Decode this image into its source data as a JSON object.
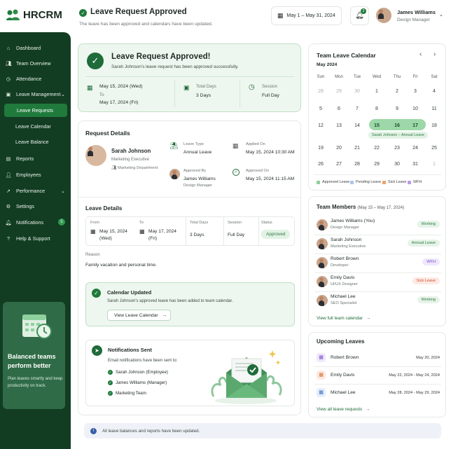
{
  "app": {
    "name": "HRCRM"
  },
  "header": {
    "title": "Leave Request Approved",
    "subtitle": "The leave has been approved and calendars have been updated.",
    "date_range": "May 1 – May 31, 2024",
    "notif_count": "3",
    "user_name": "James Williams",
    "user_role": "Design Manager"
  },
  "sidebar": {
    "items": [
      {
        "label": "Dashboard",
        "icon": "home-icon"
      },
      {
        "label": "Team Overview",
        "icon": "users-icon"
      },
      {
        "label": "Attendance",
        "icon": "clock-icon"
      },
      {
        "label": "Leave Management",
        "icon": "briefcase-icon"
      },
      {
        "label": "Leave Requests"
      },
      {
        "label": "Leave Calendar"
      },
      {
        "label": "Leave Balance"
      },
      {
        "label": "Reports",
        "icon": "chart-icon"
      },
      {
        "label": "Employees",
        "icon": "person-icon"
      },
      {
        "label": "Performance",
        "icon": "trend-icon"
      },
      {
        "label": "Settings",
        "icon": "gear-icon"
      },
      {
        "label": "Notifications",
        "icon": "bell-icon",
        "badge": "5"
      },
      {
        "label": "Help & Support",
        "icon": "help-icon"
      }
    ],
    "promo": {
      "title": "Balanced teams perform better",
      "text": "Plan leaves smartly and keep productivity on track."
    }
  },
  "banner": {
    "title": "Leave Request Approved!",
    "subtitle": "Sarah Johnson's leave request has been approved successfully.",
    "date_from": "May 15, 2024 (Wed)",
    "to_label": "To",
    "date_to": "May 17, 2024 (Fri)",
    "total_label": "Total Days",
    "total_value": "3 Days",
    "session_label": "Session",
    "session_value": "Full Day"
  },
  "request": {
    "title": "Request Details",
    "name": "Sarah Johnson",
    "role": "Marketing Executive",
    "dept": "Marketing Department",
    "leave_type_label": "Leave Type",
    "leave_type": "Annual Leave",
    "applied_label": "Applied On",
    "applied": "May 15, 2024 10:30 AM",
    "approved_by_label": "Approved By",
    "approver": "James Williams",
    "approver_role": "Design Manager",
    "approved_on_label": "Approved On",
    "approved_on": "May 15, 2024 11:15 AM"
  },
  "leave_details": {
    "title": "Leave Details",
    "from_label": "From",
    "from": "May 15, 2024 (Wed)",
    "to_label": "To",
    "to": "May 17, 2024 (Fri)",
    "total_label": "Total Days",
    "total": "3 Days",
    "session_label": "Session",
    "session": "Full Day",
    "status_label": "Status",
    "status": "Approved",
    "reason_label": "Reason",
    "reason": "Family vacation and personal time."
  },
  "calendar_updated": {
    "title": "Calendar Updated",
    "text": "Sarah Johnson's approved leave has been added to team calendar.",
    "button": "View Leave Calendar"
  },
  "notifications": {
    "title": "Notifications Sent",
    "text": "Email notifications have been sent to:",
    "recipients": [
      "Sarah Johnson (Employee)",
      "James Williams (Manager)",
      "Marketing Team"
    ]
  },
  "footer_note": "All leave balances and reports have been updated.",
  "team_calendar": {
    "title": "Team Leave Calendar",
    "month": "May 2024",
    "weekdays": [
      "Sun",
      "Mon",
      "Tue",
      "Wed",
      "Thu",
      "Fri",
      "Sat"
    ],
    "weeks": [
      [
        "28",
        "29",
        "30",
        "1",
        "2",
        "3",
        "4"
      ],
      [
        "5",
        "6",
        "7",
        "8",
        "9",
        "10",
        "11"
      ],
      [
        "12",
        "13",
        "14",
        "15",
        "16",
        "17",
        "18"
      ],
      [
        "19",
        "20",
        "21",
        "22",
        "23",
        "24",
        "25"
      ],
      [
        "26",
        "27",
        "28",
        "29",
        "30",
        "31",
        "1"
      ]
    ],
    "highlight_label": "Sarah Johnson – Annual Leave",
    "legend": [
      {
        "label": "Approved Leave",
        "color": "#8fcf9c"
      },
      {
        "label": "Pending Leave",
        "color": "#a8c6ef"
      },
      {
        "label": "Sick Leave",
        "color": "#f2a06a"
      },
      {
        "label": "WFH",
        "color": "#b79af0"
      }
    ]
  },
  "team_members": {
    "title": "Team Members",
    "range": "(May 15 – May 17, 2024)",
    "link": "View full team calendar",
    "members": [
      {
        "name": "James Williams (You)",
        "role": "Design Manager",
        "status": "Working",
        "bg": "#e6f3e8",
        "fg": "#2f7a43"
      },
      {
        "name": "Sarah Johnson",
        "role": "Marketing Executive",
        "status": "Annual Leave",
        "bg": "#e6f3e8",
        "fg": "#2f7a43"
      },
      {
        "name": "Robert Brown",
        "role": "Developer",
        "status": "WFH",
        "bg": "#efe7fb",
        "fg": "#7a4fc9"
      },
      {
        "name": "Emily Davis",
        "role": "UI/UX Designer",
        "status": "Sick Leave",
        "bg": "#fde9e3",
        "fg": "#d2512e"
      },
      {
        "name": "Michael Lee",
        "role": "SEO Specialist",
        "status": "Working",
        "bg": "#e6f3e8",
        "fg": "#2f7a43"
      }
    ]
  },
  "upcoming": {
    "title": "Upcoming Leaves",
    "link": "View all leave requests",
    "items": [
      {
        "name": "Robert Brown",
        "date": "May 20, 2024",
        "color": "#7a4fc9",
        "bg": "#efe7fb"
      },
      {
        "name": "Emily Davis",
        "date": "May 22, 2024 - May 24, 2024",
        "color": "#d2712e",
        "bg": "#fde9e3"
      },
      {
        "name": "Michael Lee",
        "date": "May 28, 2024 - May 29, 2024",
        "color": "#3a6fc7",
        "bg": "#e4edfa"
      }
    ]
  }
}
